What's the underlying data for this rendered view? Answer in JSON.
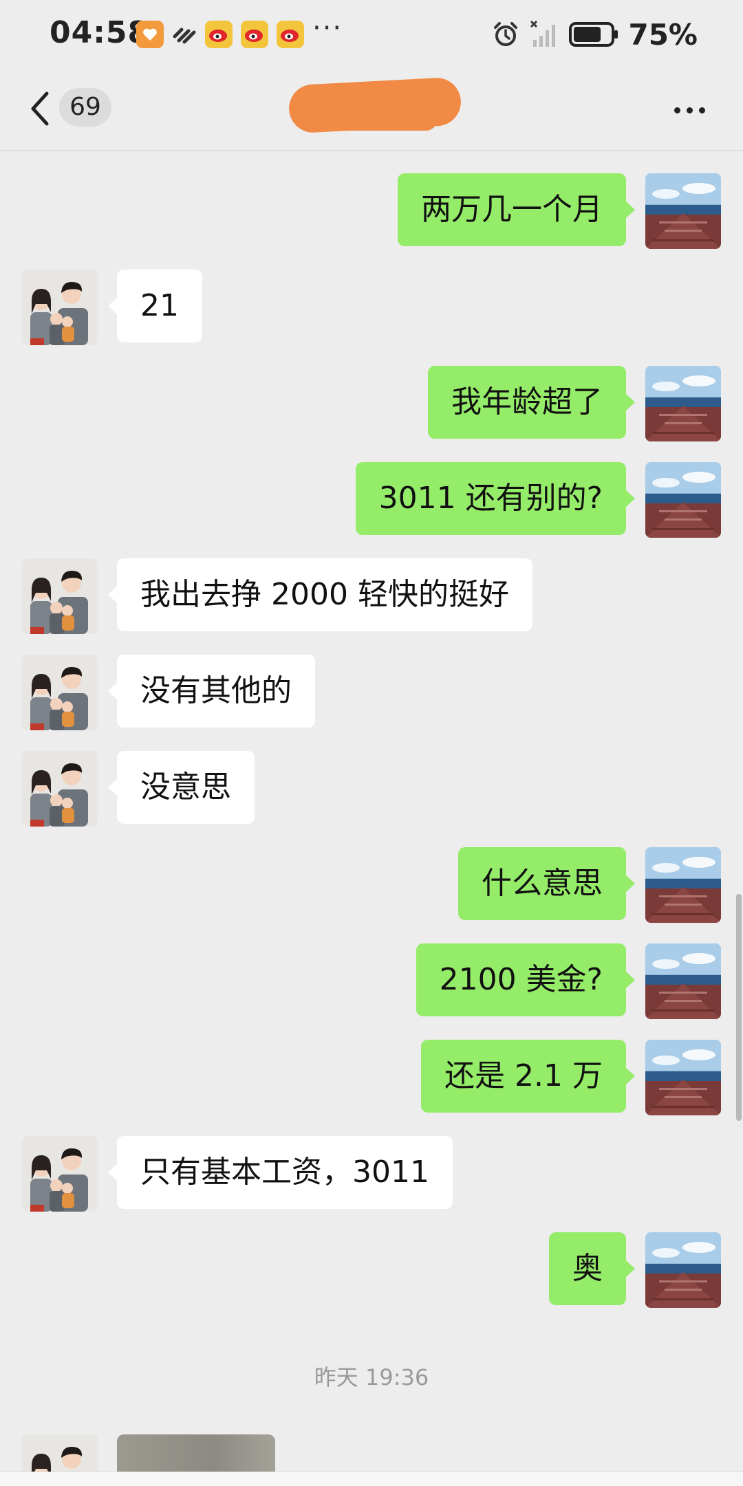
{
  "status_bar": {
    "time": "04:58",
    "dots": "···",
    "battery_percent": "75%",
    "battery_level": 0.75,
    "icons": [
      "app-heart-icon",
      "app-stripes-icon",
      "weibo-icon",
      "weibo-icon",
      "weibo-icon",
      "alarm-icon",
      "signal-off-icon",
      "battery-icon"
    ]
  },
  "header": {
    "unread_count": "69",
    "title_redacted": true
  },
  "messages": [
    {
      "side": "me",
      "text": "两万几一个月"
    },
    {
      "side": "them",
      "text": "21"
    },
    {
      "side": "me",
      "text": "我年龄超了"
    },
    {
      "side": "me",
      "text": "3011 还有别的?"
    },
    {
      "side": "them",
      "text": "我出去挣 2000 轻快的挺好"
    },
    {
      "side": "them",
      "text": "没有其他的"
    },
    {
      "side": "them",
      "text": "没意思"
    },
    {
      "side": "me",
      "text": "什么意思"
    },
    {
      "side": "me",
      "text": "2100 美金?"
    },
    {
      "side": "me",
      "text": "还是 2.1 万"
    },
    {
      "side": "them",
      "text": "只有基本工资，3011"
    },
    {
      "side": "me",
      "text": "奥"
    }
  ],
  "timestamp": "昨天 19:36",
  "colors": {
    "background": "#ededed",
    "my_bubble": "#95ec69",
    "their_bubble": "#ffffff",
    "redaction": "#f08a45"
  }
}
